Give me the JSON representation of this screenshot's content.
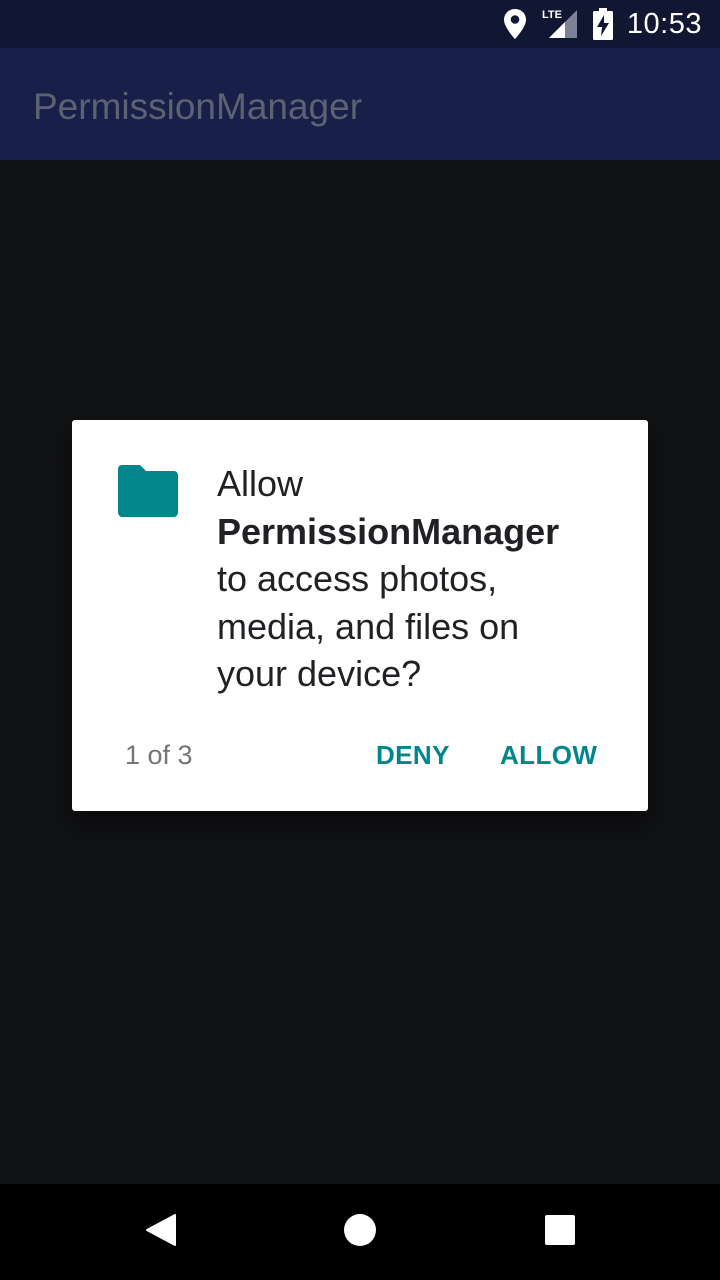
{
  "status_bar": {
    "time": "10:53",
    "network_label": "LTE",
    "icons": [
      "location-icon",
      "lte-signal-icon",
      "battery-charging-icon"
    ]
  },
  "app_bar": {
    "title": "PermissionManager",
    "title_color": "#5d6273",
    "background": "#18204a"
  },
  "dialog": {
    "icon": "folder-icon",
    "icon_color": "#00868b",
    "message_prefix": "Allow",
    "app_name": "PermissionManager",
    "message_line_1": "to access photos,",
    "message_line_2": "media, and files on",
    "message_line_3": "your device?",
    "counter": "1 of 3",
    "deny_label": "DENY",
    "allow_label": "ALLOW",
    "accent_color": "#00868b"
  },
  "nav_bar": {
    "icons": [
      "back-icon",
      "home-icon",
      "recents-icon"
    ]
  }
}
